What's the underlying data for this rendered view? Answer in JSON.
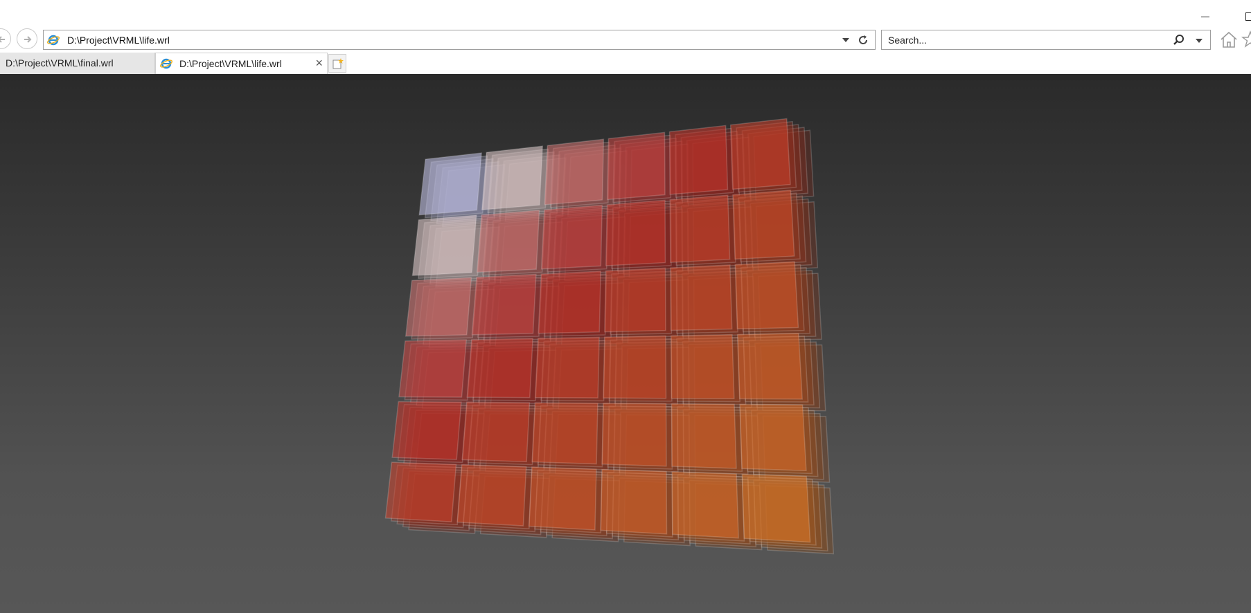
{
  "window": {
    "minimize_icon": "minimize-icon",
    "maximize_icon": "maximize-icon"
  },
  "navigation": {
    "back_icon": "arrow-left-icon",
    "forward_icon": "arrow-right-icon"
  },
  "address_bar": {
    "url": "D:\\Project\\VRML\\life.wrl",
    "site_icon": "internet-explorer-icon",
    "dropdown_icon": "chevron-down-icon",
    "refresh_icon": "refresh-icon"
  },
  "search_bar": {
    "placeholder": "Search...",
    "search_icon": "magnifier-icon",
    "dropdown_icon": "chevron-down-icon"
  },
  "toolbar": {
    "home_icon": "home-icon",
    "favorites_icon": "star-icon"
  },
  "tabs": [
    {
      "label": "D:\\Project\\VRML\\final.wrl",
      "active": false
    },
    {
      "label": "D:\\Project\\VRML\\life.wrl",
      "active": true,
      "close_label": "×"
    }
  ],
  "new_tab_icon": "new-tab-icon",
  "viewer": {
    "content": "6x6x6 translucent cube grid (VRML scene)",
    "grid_size": 6,
    "colors": {
      "top_left": "#c8c8ee",
      "near_white": "#e8d2d2",
      "red": "#c8302c",
      "orange": "#e07828",
      "background_top": "#2a2a2a",
      "background_bottom": "#575757"
    }
  }
}
